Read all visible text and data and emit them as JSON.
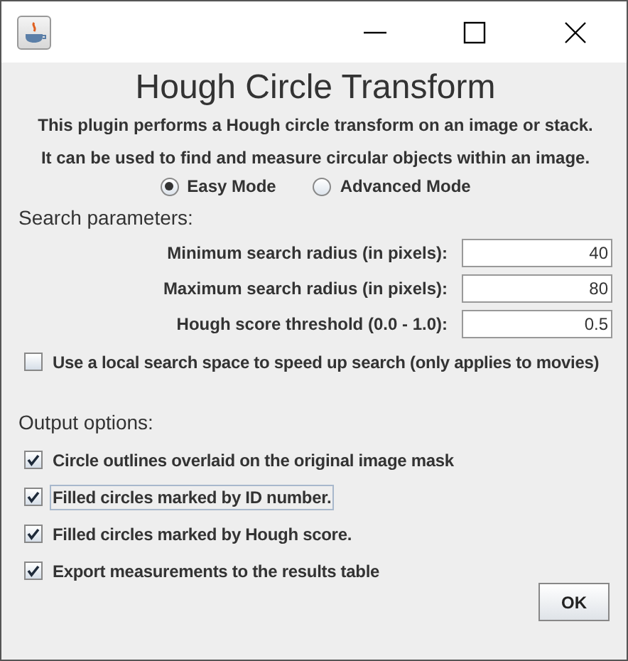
{
  "window": {
    "title": "Hough Circle Transform"
  },
  "description": [
    "This plugin performs a Hough circle transform on an image or stack.",
    "It can be used to find and measure circular objects within an image."
  ],
  "modes": [
    {
      "label": "Easy Mode",
      "selected": true
    },
    {
      "label": "Advanced Mode",
      "selected": false
    }
  ],
  "search_parameters": {
    "heading": "Search parameters:",
    "fields": [
      {
        "label": "Minimum search radius (in pixels):",
        "value": "40"
      },
      {
        "label": "Maximum search radius (in pixels):",
        "value": "80"
      },
      {
        "label": "Hough score threshold (0.0 - 1.0):",
        "value": "0.5"
      }
    ],
    "local_search": {
      "label": "Use a local search space to speed up search (only applies to movies)",
      "checked": false
    }
  },
  "output_options": {
    "heading": "Output options:",
    "items": [
      {
        "label": "Circle outlines overlaid on the original image mask",
        "checked": true,
        "focused": false
      },
      {
        "label": "Filled circles marked by ID number.",
        "checked": true,
        "focused": true
      },
      {
        "label": "Filled circles marked by Hough score.",
        "checked": true,
        "focused": false
      },
      {
        "label": "Export measurements to the results table",
        "checked": true,
        "focused": false
      }
    ]
  },
  "buttons": [
    "OK"
  ]
}
